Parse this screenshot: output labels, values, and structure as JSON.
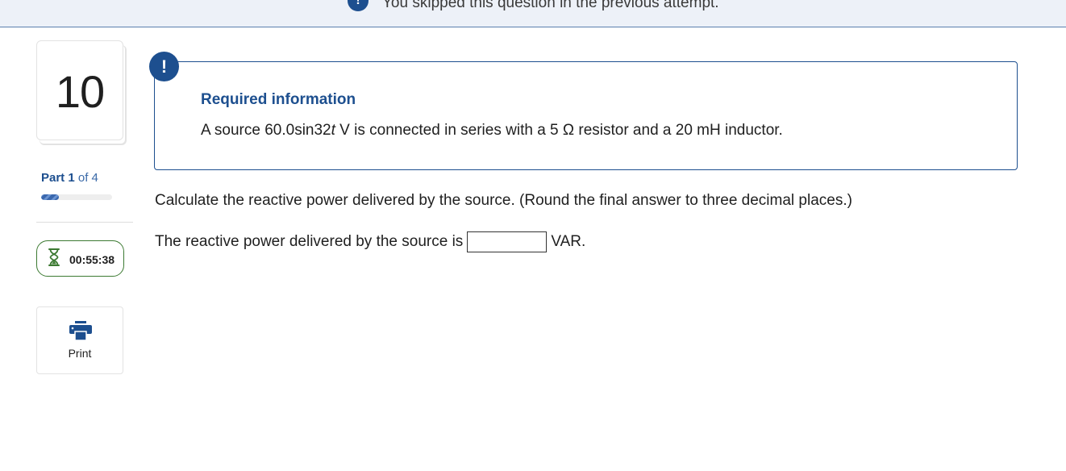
{
  "banner": {
    "icon": "alert-icon",
    "text": "You skipped this question in the previous attempt."
  },
  "question_number": "10",
  "part": {
    "label": "Part",
    "current": "1",
    "of_text": "of 4",
    "progress_fraction": 0.25
  },
  "timer": {
    "icon": "hourglass-icon",
    "value": "00:55:38"
  },
  "print": {
    "icon": "printer-icon",
    "label": "Print"
  },
  "required_info": {
    "icon": "exclamation-icon",
    "title": "Required information",
    "text_before": "A source 60.0sin32",
    "text_var": "t",
    "text_after": " V is connected in series with a 5 Ω resistor and a 20 mH inductor."
  },
  "question": {
    "text": "Calculate the reactive power delivered by the source. (Round the final answer to three decimal places.)",
    "answer_prefix": "The reactive power delivered by the source is",
    "answer_value": "",
    "answer_unit": "VAR."
  }
}
